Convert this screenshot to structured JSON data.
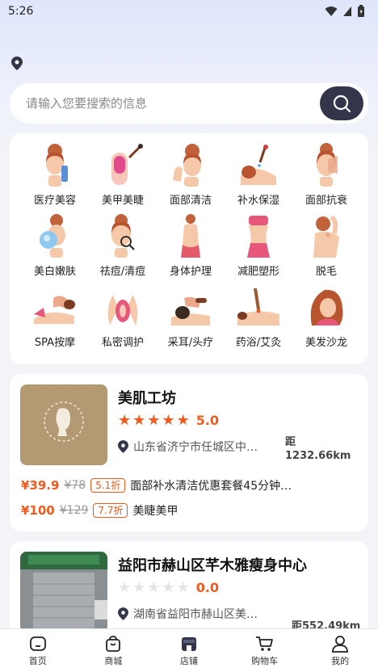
{
  "status": {
    "time": "5:26"
  },
  "search": {
    "placeholder": "请输入您要搜索的信息"
  },
  "categories": [
    {
      "label": "医疗美容",
      "icon": "woman-face-icon"
    },
    {
      "label": "美甲美睫",
      "icon": "nail-polish-icon"
    },
    {
      "label": "面部清洁",
      "icon": "face-clean-icon"
    },
    {
      "label": "补水保湿",
      "icon": "dropper-icon"
    },
    {
      "label": "面部抗衰",
      "icon": "face-care-icon"
    },
    {
      "label": "美白嫩肤",
      "icon": "skin-whitening-icon"
    },
    {
      "label": "祛痘/清痘",
      "icon": "acne-magnifier-icon"
    },
    {
      "label": "身体护理",
      "icon": "body-care-icon"
    },
    {
      "label": "减肥塑形",
      "icon": "slimming-icon"
    },
    {
      "label": "脱毛",
      "icon": "hair-removal-icon"
    },
    {
      "label": "SPA按摩",
      "icon": "massage-icon"
    },
    {
      "label": "私密调护",
      "icon": "private-care-icon"
    },
    {
      "label": "采耳/头疗",
      "icon": "head-therapy-icon"
    },
    {
      "label": "药浴/艾灸",
      "icon": "moxibustion-icon"
    },
    {
      "label": "美发沙龙",
      "icon": "hair-salon-icon"
    }
  ],
  "shops": [
    {
      "name": "美肌工坊",
      "rating": "5.0",
      "stars": 5,
      "address": "山东省济宁市任城区中…",
      "distance_label": "距",
      "distance": "1232.66km",
      "deals": [
        {
          "price": "¥39.9",
          "original": "¥78",
          "discount": "5.1折",
          "title": "面部补水清洁优惠套餐45分钟…"
        },
        {
          "price": "¥100",
          "original": "¥129",
          "discount": "7.7折",
          "title": "美睫美甲"
        }
      ]
    },
    {
      "name": "益阳市赫山区芊木雅瘦身中心",
      "rating": "0.0",
      "stars": 0,
      "address": "湖南省益阳市赫山区美…",
      "distance": "距552.49km"
    }
  ],
  "tabs": [
    {
      "label": "首页",
      "icon": "home-icon"
    },
    {
      "label": "商城",
      "icon": "shopping-bag-icon"
    },
    {
      "label": "店铺",
      "icon": "store-icon"
    },
    {
      "label": "购物车",
      "icon": "cart-icon"
    },
    {
      "label": "我的",
      "icon": "user-icon"
    }
  ],
  "colors": {
    "accent": "#f05a1e",
    "search_button": "#33364a",
    "background": "#f3f4f8"
  }
}
